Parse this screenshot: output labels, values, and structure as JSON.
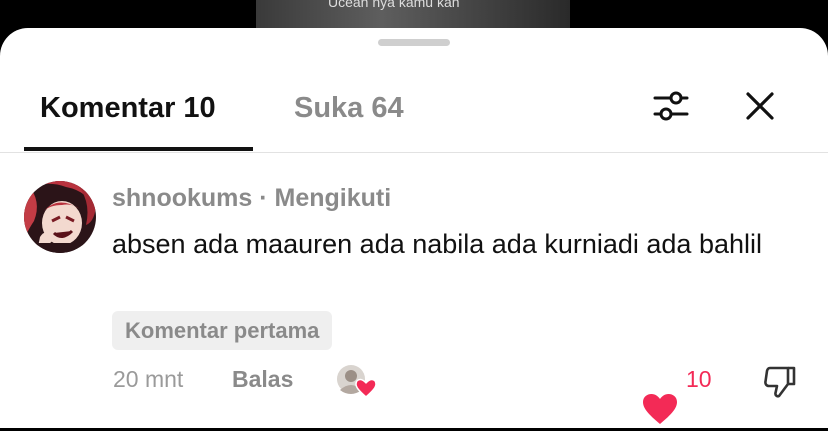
{
  "video": {
    "caption_partial": "Ucean nya kamu kan"
  },
  "tabs": [
    {
      "label": "Komentar 10",
      "active": true
    },
    {
      "label": "Suka 64",
      "active": false
    }
  ],
  "toolbar": {
    "filter_icon": "sliders-icon",
    "close_icon": "close-icon"
  },
  "comment": {
    "username": "shnookums",
    "separator": " · ",
    "relation": "Mengikuti",
    "text": "absen ada maauren ada nabila ada kurniadi ada bahlil",
    "badge": "Komentar pertama",
    "time": "20 mnt",
    "reply_label": "Balas",
    "like_count": "10"
  },
  "colors": {
    "like": "#f32a56",
    "muted_text": "#8a8a8a",
    "primary_text": "#111111",
    "chip_bg": "#efefef"
  }
}
